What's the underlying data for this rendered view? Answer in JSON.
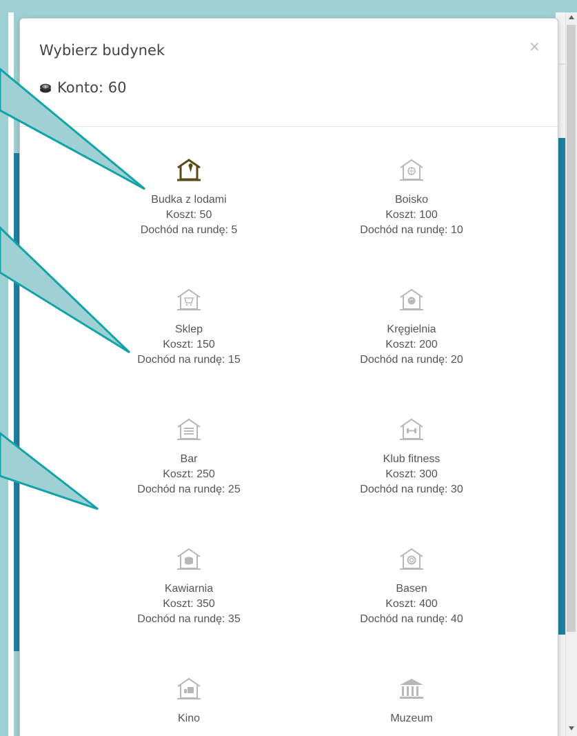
{
  "modal": {
    "title": "Wybierz budynek",
    "close_label": "×",
    "account_label": "Konto: 60"
  },
  "buildings": [
    {
      "name": "Budka z lodami",
      "cost": "Koszt: 50",
      "income": "Dochód na rundę: 5",
      "icon": "ice-cream-house-icon",
      "active": true
    },
    {
      "name": "Boisko",
      "cost": "Koszt: 100",
      "income": "Dochód na rundę: 10",
      "icon": "basketball-house-icon",
      "active": false
    },
    {
      "name": "Sklep",
      "cost": "Koszt: 150",
      "income": "Dochód na rundę: 15",
      "icon": "shop-cart-house-icon",
      "active": false
    },
    {
      "name": "Kręgielnia",
      "cost": "Koszt: 200",
      "income": "Dochód na rundę: 20",
      "icon": "bowling-house-icon",
      "active": false
    },
    {
      "name": "Bar",
      "cost": "Koszt: 250",
      "income": "Dochód na rundę: 25",
      "icon": "bar-house-icon",
      "active": false
    },
    {
      "name": "Klub fitness",
      "cost": "Koszt: 300",
      "income": "Dochód na rundę: 30",
      "icon": "dumbbell-house-icon",
      "active": false
    },
    {
      "name": "Kawiarnia",
      "cost": "Koszt: 350",
      "income": "Dochód na rundę: 35",
      "icon": "coffee-house-icon",
      "active": false
    },
    {
      "name": "Basen",
      "cost": "Koszt: 400",
      "income": "Dochód na rundę: 40",
      "icon": "pool-house-icon",
      "active": false
    },
    {
      "name": "Kino",
      "cost": "",
      "income": "",
      "icon": "cinema-house-icon",
      "active": false
    },
    {
      "name": "Muzeum",
      "cost": "",
      "income": "",
      "icon": "museum-icon",
      "active": false
    }
  ],
  "colors": {
    "active_icon": "#5a4a1a",
    "inactive_icon": "#b8b8b8",
    "callout_fill": "#9fd0d3",
    "callout_stroke": "#12a3a8",
    "sidebar_blue": "#1f7fa3"
  }
}
